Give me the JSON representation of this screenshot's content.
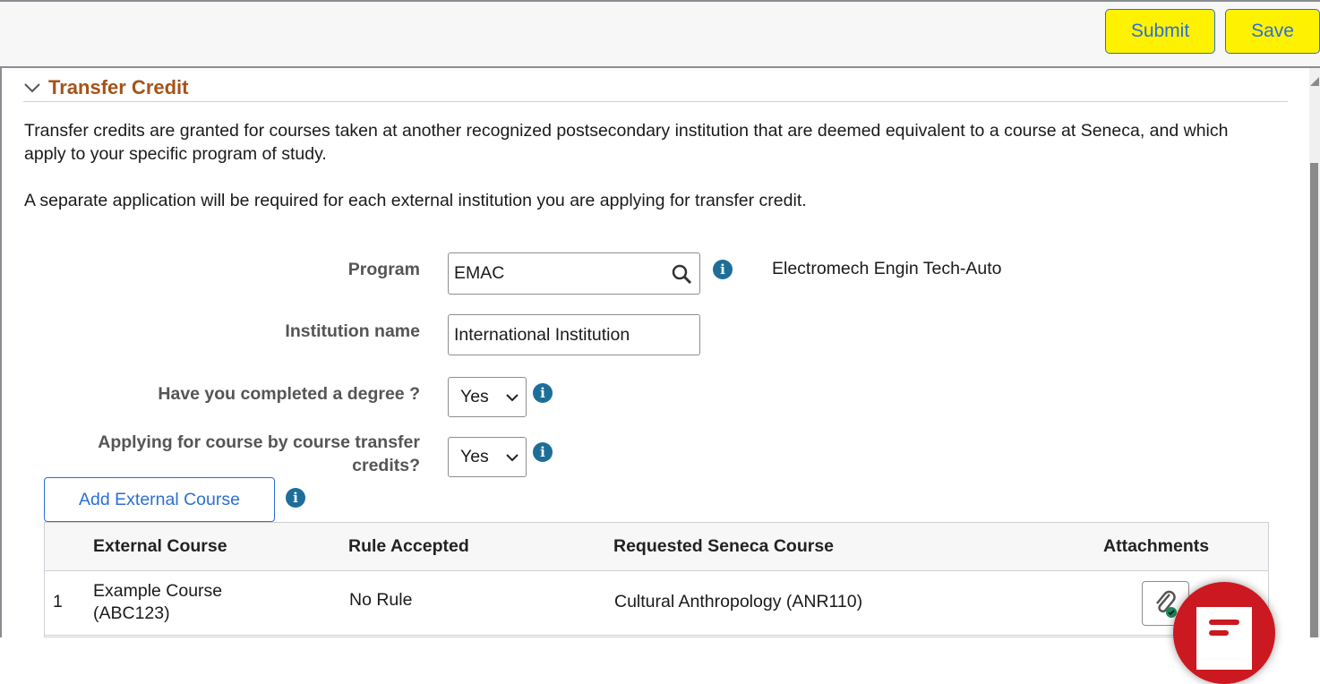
{
  "toolbar": {
    "submit_label": "Submit",
    "save_label": "Save"
  },
  "section": {
    "title": "Transfer Credit",
    "intro": "Transfer credits are granted for courses taken at another recognized postsecondary institution that are deemed equivalent to a course at Seneca, and which apply to your specific program of study.",
    "note": "A separate application will be required for each external institution you are applying for transfer credit."
  },
  "form": {
    "program": {
      "label": "Program",
      "value": "EMAC",
      "description": "Electromech Engin Tech-Auto"
    },
    "institution": {
      "label": "Institution name",
      "value": "International Institution"
    },
    "degree": {
      "label": "Have you completed a degree ?",
      "value": "Yes"
    },
    "course_by_course": {
      "label_line1": "Applying for course by course transfer",
      "label_line2": "credits?",
      "value": "Yes"
    },
    "add_button": "Add External Course"
  },
  "table": {
    "headers": [
      "External Course",
      "Rule Accepted",
      "Requested Seneca Course",
      "Attachments"
    ],
    "rows": [
      {
        "num": "1",
        "external_line1": "Example Course",
        "external_line2": "(ABC123)",
        "rule": "No Rule",
        "requested": "Cultural Anthropology (ANR110)",
        "attachment_icon": "paperclip-check-icon"
      }
    ]
  },
  "colors": {
    "accent": "#2b6fd6",
    "button_bg": "#fff200",
    "section_title": "#a5531a",
    "info": "#1d6e98",
    "fab": "#cc1820"
  }
}
